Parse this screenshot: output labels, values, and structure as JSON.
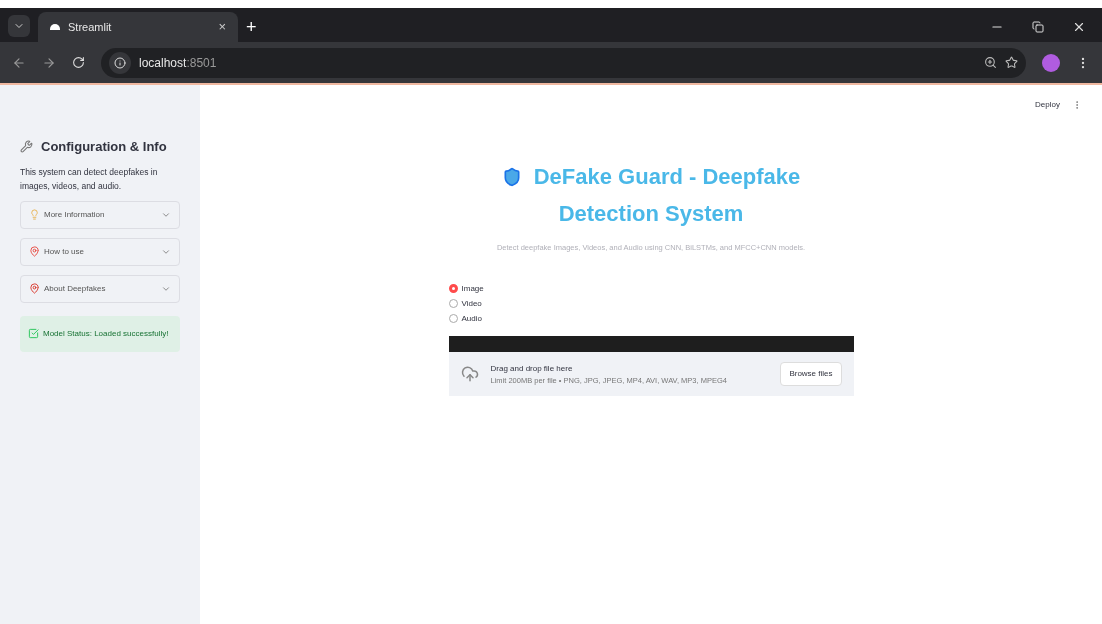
{
  "browser": {
    "tab_title": "Streamlit",
    "tab_close": "×",
    "new_tab": "+",
    "url_host": "localhost",
    "url_port": ":8501"
  },
  "header": {
    "deploy": "Deploy"
  },
  "sidebar": {
    "title": "Configuration & Info",
    "description": "This system can detect deepfakes in images, videos, and audio.",
    "expanders": [
      {
        "label": "More Information",
        "expanded": false
      },
      {
        "label": "How to use",
        "expanded": false
      },
      {
        "label": "About Deepfakes",
        "expanded": false
      }
    ],
    "status": "Model Status: Loaded successfully!"
  },
  "main": {
    "title_line1": "DeFake Guard - Deepfake",
    "title_line2": "Detection System",
    "subtitle": "Detect deepfake Images, Videos, and Audio using CNN, BiLSTMs, and MFCC+CNN models.",
    "media_types": [
      {
        "label": "Image",
        "selected": true
      },
      {
        "label": "Video",
        "selected": false
      },
      {
        "label": "Audio",
        "selected": false
      }
    ],
    "uploader": {
      "drop_text": "Drag and drop file here",
      "limit_text": "Limit 200MB per file • PNG, JPG, JPEG, MP4, AVI, WAV, MP3, MPEG4",
      "button": "Browse files"
    }
  }
}
